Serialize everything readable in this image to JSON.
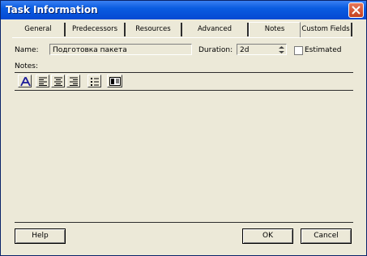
{
  "window": {
    "title": "Task Information"
  },
  "tabs": [
    {
      "label": "General"
    },
    {
      "label": "Predecessors"
    },
    {
      "label": "Resources"
    },
    {
      "label": "Advanced"
    },
    {
      "label": "Notes"
    },
    {
      "label": "Custom Fields"
    }
  ],
  "active_tab": "Notes",
  "form": {
    "name_label": "Name:",
    "name_value": "Подготовка пакета",
    "duration_label": "Duration:",
    "duration_value": "2d",
    "estimated_label": "Estimated",
    "estimated_checked": false,
    "notes_label": "Notes:",
    "notes_value": ""
  },
  "toolbar": {
    "icons": [
      "font-icon",
      "align-left-icon",
      "align-center-icon",
      "align-right-icon",
      "bullet-list-icon",
      "insert-object-icon"
    ]
  },
  "buttons": {
    "help": "Help",
    "ok": "OK",
    "cancel": "Cancel"
  },
  "colors": {
    "titlebar": "#0a5ce0",
    "dialog_bg": "#ece9d8",
    "close_button": "#c4401f"
  }
}
